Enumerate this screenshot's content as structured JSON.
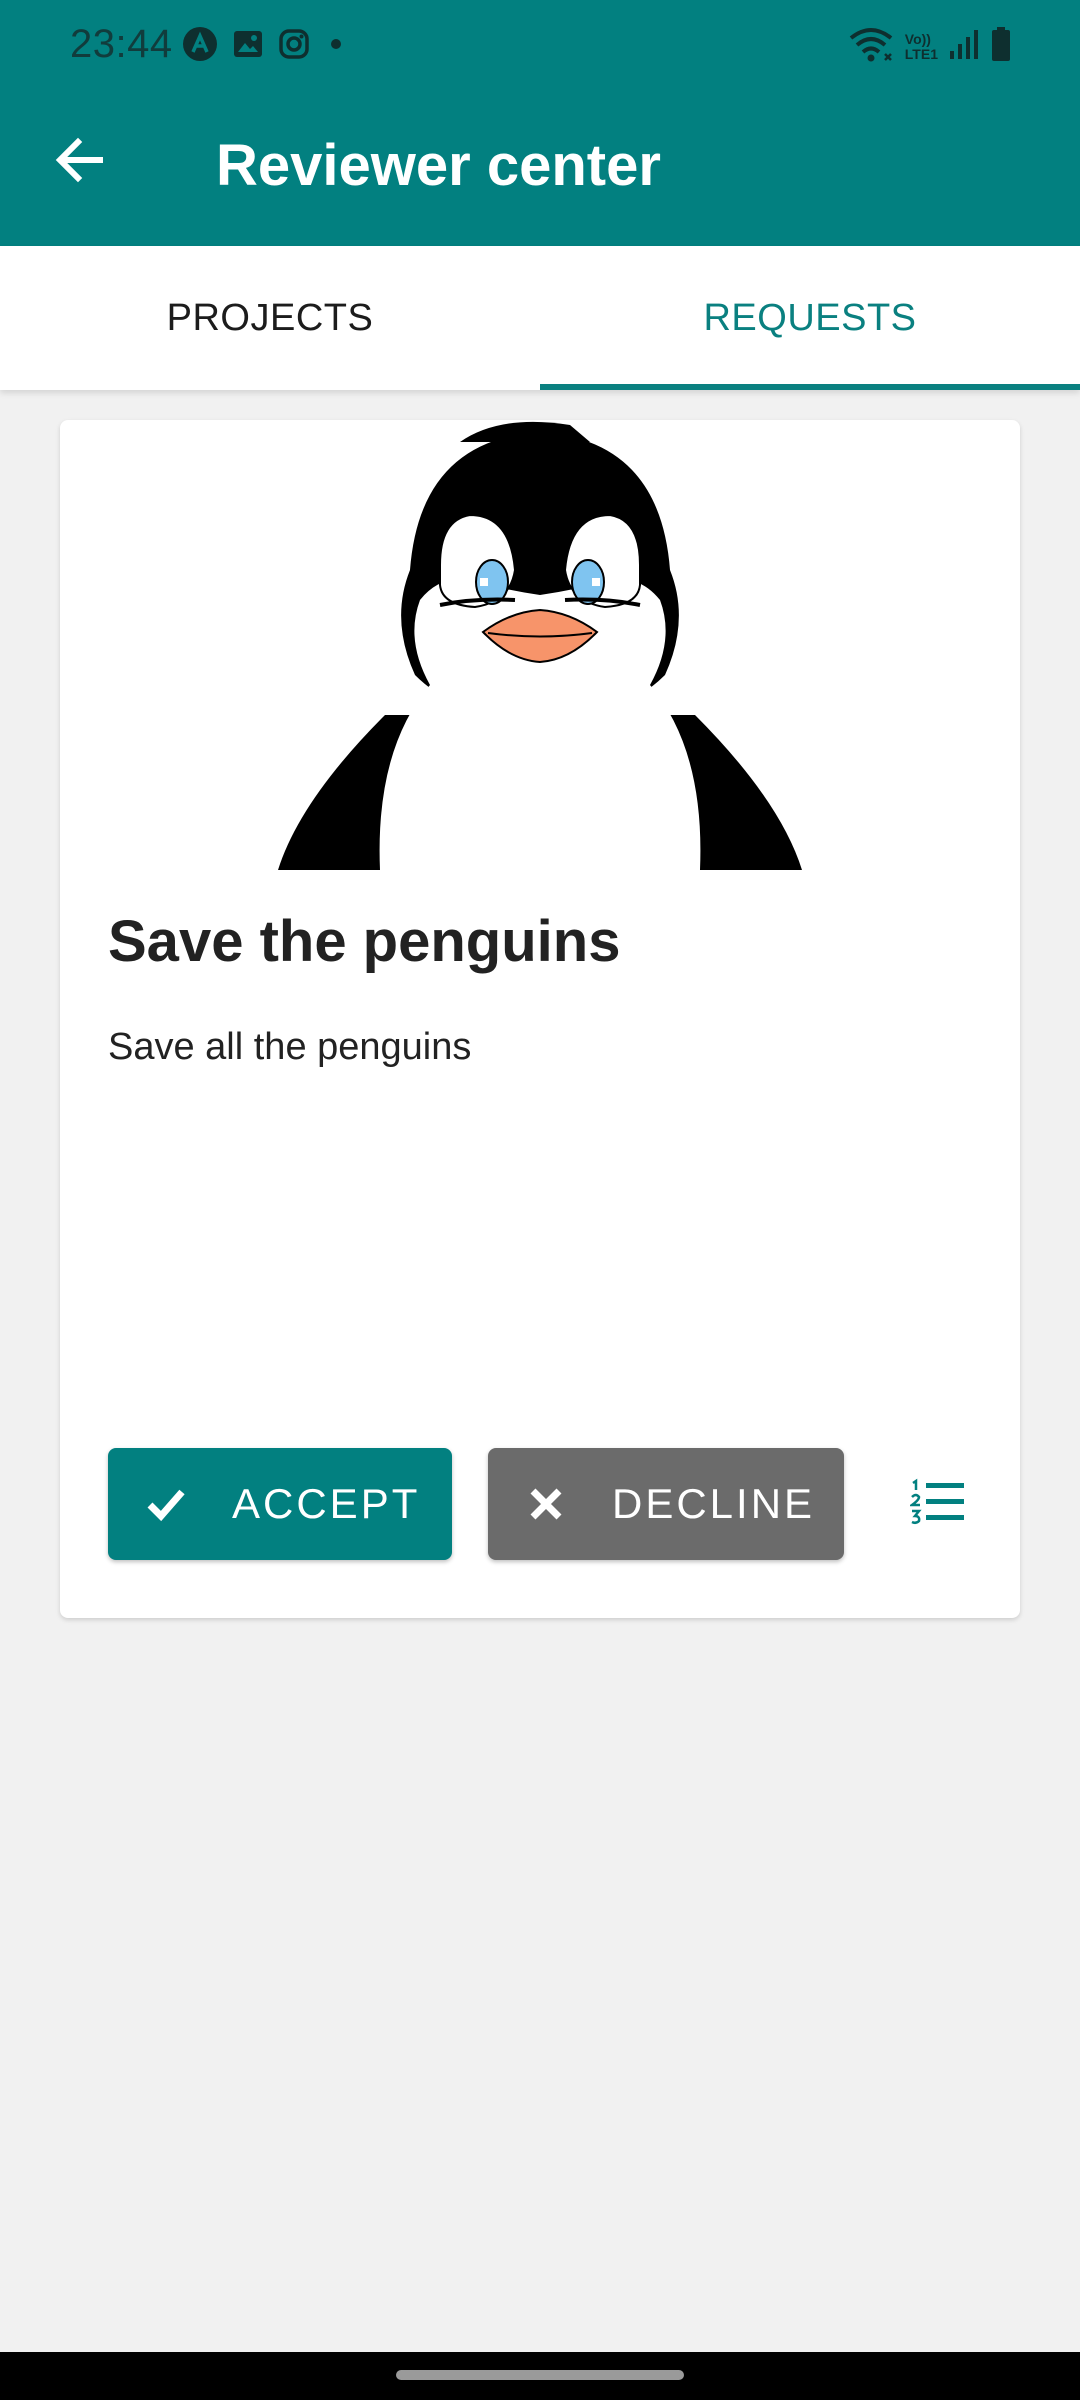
{
  "status_bar": {
    "time": "23:44",
    "left_icons": [
      "app-a-icon",
      "gallery-icon",
      "instagram-icon",
      "dot-icon"
    ],
    "right_icons": [
      "wifi-icon",
      "volte-icon",
      "signal-icon",
      "battery-icon"
    ],
    "volte_label_top": "Vo))",
    "volte_label_bottom": "LTE1"
  },
  "app_bar": {
    "title": "Reviewer center",
    "back_icon": "arrow-back-icon"
  },
  "tabs": [
    {
      "label": "PROJECTS",
      "active": false
    },
    {
      "label": "REQUESTS",
      "active": true
    }
  ],
  "request_card": {
    "image": "penguin-illustration",
    "title": "Save the penguins",
    "description": "Save all the penguins",
    "accept_label": "ACCEPT",
    "decline_label": "DECLINE",
    "accept_icon": "check-icon",
    "decline_icon": "close-icon",
    "list_icon": "numbered-list-icon"
  },
  "colors": {
    "primary": "#028080",
    "accent_text": "#0a8080",
    "decline": "#6b6b6b",
    "background": "#f1f1f1"
  }
}
